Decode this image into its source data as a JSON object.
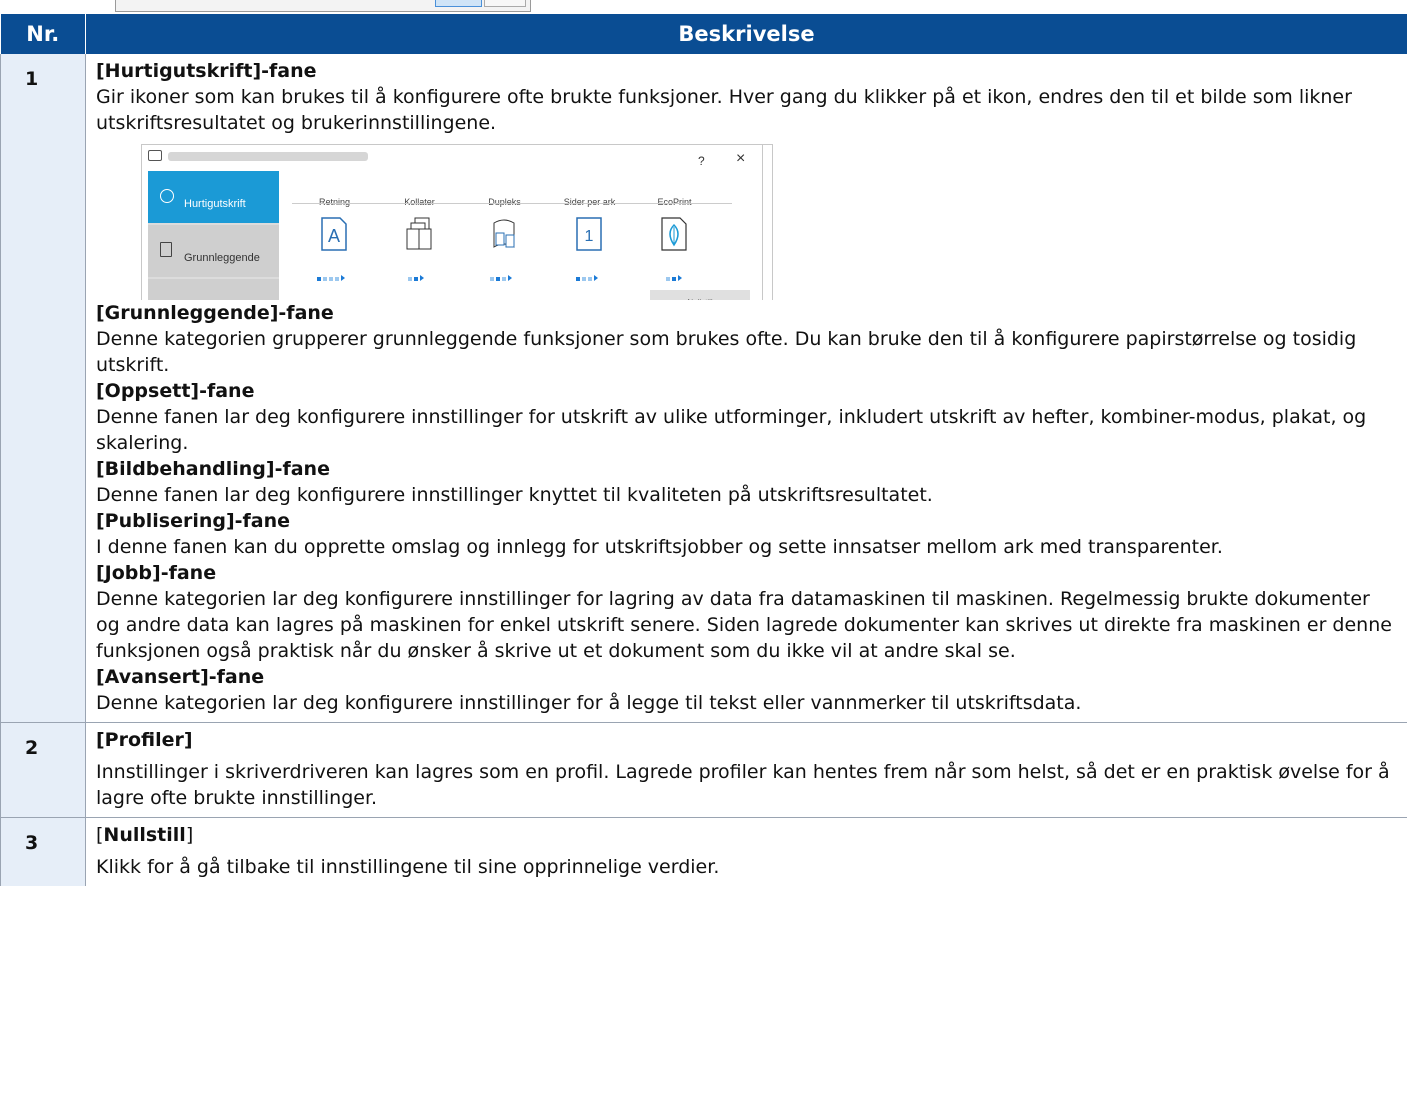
{
  "header": {
    "col_nr": "Nr.",
    "col_desc": "Beskrivelse"
  },
  "rows": [
    {
      "nr": "1",
      "sections": [
        {
          "title": "[Hurtigutskrift]-fane",
          "text": "Gir ikoner som kan brukes til å konfigurere ofte brukte funksjoner. Hver gang du klikker på et ikon, endres den til et bilde som likner utskriftsresultatet og brukerinnstillingene."
        },
        {
          "title": "[Grunnleggende]-fane",
          "text": "Denne kategorien grupperer grunnleggende funksjoner som brukes ofte. Du kan bruke den til å konfigurere papirstørrelse og tosidig utskrift."
        },
        {
          "title": "[Oppsett]-fane",
          "text": "Denne fanen lar deg konfigurere innstillinger for utskrift av ulike utforminger, inkludert utskrift av hefter, kombiner-modus, plakat, og skalering."
        },
        {
          "title": "[Bildbehandling]-fane",
          "text": "Denne fanen lar deg konfigurere innstillinger knyttet til kvaliteten på utskriftsresultatet."
        },
        {
          "title": "[Publisering]-fane",
          "text": "I denne fanen kan du opprette omslag og innlegg for utskriftsjobber og sette innsatser mellom ark med transparenter."
        },
        {
          "title": "[Jobb]-fane",
          "text": "Denne kategorien lar deg konfigurere innstillinger for lagring av data fra datamaskinen til maskinen. Regelmessig brukte dokumenter og andre data kan lagres på maskinen for enkel utskrift senere. Siden lagrede dokumenter kan skrives ut direkte fra maskinen er denne funksjonen også praktisk når du ønsker å skrive ut et dokument som du ikke vil at andre skal se."
        },
        {
          "title": "[Avansert]-fane",
          "text": "Denne kategorien lar deg konfigurere innstillinger for å legge til tekst eller vannmerker til utskriftsdata."
        }
      ]
    },
    {
      "nr": "2",
      "title": "[Profiler]",
      "text": "Innstillinger i skriverdriveren kan lagres som en profil. Lagrede profiler kan hentes frem når som helst, så det er en praktisk øvelse for å lagre ofte brukte innstillinger."
    },
    {
      "nr": "3",
      "title_open": "[",
      "title_bold": "Nullstill",
      "title_close": "]",
      "text": "Klikk for å gå tilbake til innstillingene til sine opprinnelige verdier."
    }
  ],
  "dialog": {
    "help": "?",
    "close": "×",
    "sidebar": [
      "Hurtigutskrift",
      "Grunnleggende"
    ],
    "options": [
      "Retning",
      "Kollater",
      "Dupleks",
      "Sider per ark",
      "EcoPrint"
    ],
    "icon_retning": "A",
    "icon_sider": "1",
    "reset": "Nullstill",
    "icons": [
      "printer-icon",
      "clock-icon",
      "document-icon",
      "orientation-icon",
      "collate-icon",
      "duplex-icon",
      "pages-per-sheet-icon",
      "ecoprint-leaf-icon"
    ]
  },
  "colors": {
    "header_bg": "#0a4d93",
    "num_bg": "#e6eef8",
    "accent": "#1b9ad6"
  }
}
